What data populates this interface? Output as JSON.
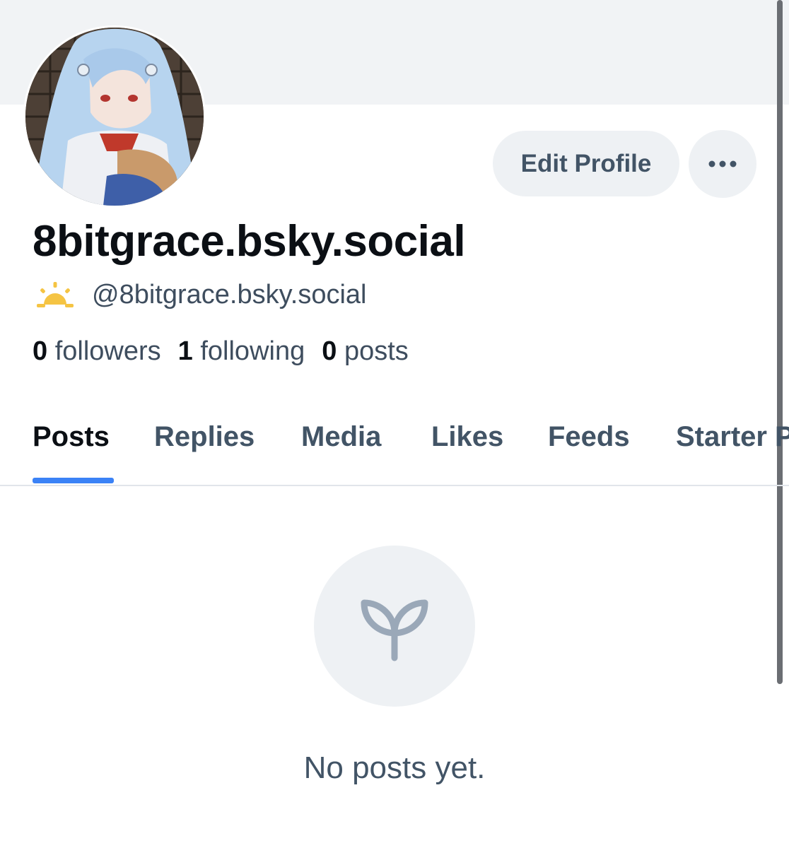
{
  "profile": {
    "display_name": "8bitgrace.bsky.social",
    "handle": "@8bitgrace.bsky.social"
  },
  "actions": {
    "edit_profile_label": "Edit Profile",
    "more_icon": "ellipsis-icon"
  },
  "stats": {
    "followers_count": "0",
    "followers_label": "followers",
    "following_count": "1",
    "following_label": "following",
    "posts_count": "0",
    "posts_label": "posts"
  },
  "tabs": [
    {
      "label": "Posts",
      "active": true
    },
    {
      "label": "Replies"
    },
    {
      "label": "Media"
    },
    {
      "label": "Likes"
    },
    {
      "label": "Feeds"
    },
    {
      "label": "Starter Packs"
    }
  ],
  "empty_state": {
    "icon": "seedling-icon",
    "message": "No posts yet."
  },
  "colors": {
    "tab_indicator": "#3b82f6",
    "secondary_text": "#425466",
    "sun_icon": "#f5c443"
  }
}
